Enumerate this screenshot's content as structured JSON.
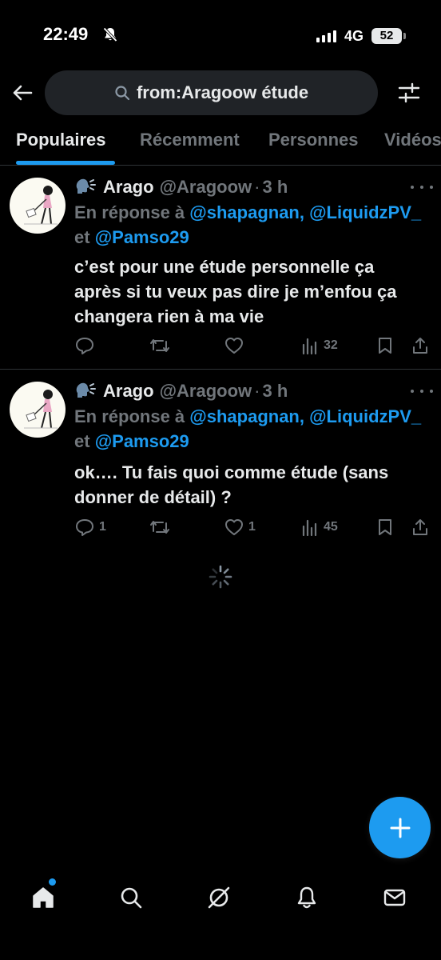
{
  "status_bar": {
    "time": "22:49",
    "network": "4G",
    "battery": "52"
  },
  "header": {
    "search_query": "from:Aragoow étude",
    "icons": [
      "back-arrow-icon",
      "search-icon",
      "filter-sliders-icon"
    ]
  },
  "tabs": [
    {
      "label": "Populaires",
      "active": true
    },
    {
      "label": "Récemment",
      "active": false
    },
    {
      "label": "Personnes",
      "active": false
    },
    {
      "label": "Vidéos",
      "active": false
    }
  ],
  "tweets": [
    {
      "emoji": "🗣️",
      "name": "Arago",
      "handle": "@Aragoow",
      "separator": "·",
      "time": "3 h",
      "reply_prefix": "En réponse à",
      "reply_mentions_1": "@shapagnan, @LiquidzPV_",
      "reply_joiner": "et",
      "reply_mentions_2": "@Pamso29",
      "text_line1": "c’est pour une étude personnelle ça",
      "text_line2": "après si tu veux pas dire je m’enfou ça",
      "text_line3": "changera rien à ma vie",
      "replies": "",
      "retweets": "",
      "likes": "",
      "views": "32"
    },
    {
      "emoji": "🗣️",
      "name": "Arago",
      "handle": "@Aragoow",
      "separator": "·",
      "time": "3 h",
      "reply_prefix": "En réponse à",
      "reply_mentions_1": "@shapagnan, @LiquidzPV_",
      "reply_joiner": "et",
      "reply_mentions_2": "@Pamso29",
      "text_line1": "ok…. Tu fais quoi comme étude (sans",
      "text_line2": "donner de détail) ?",
      "replies": "1",
      "retweets": "",
      "likes": "1",
      "views": "45"
    }
  ],
  "fab": {
    "icon": "plus-icon"
  },
  "bottom_nav": [
    "home-icon",
    "search-icon",
    "grok-icon",
    "notifications-bell-icon",
    "messages-envelope-icon"
  ],
  "colors": {
    "background": "#000000",
    "accent": "#1d9bf0",
    "secondary_text": "#71767b",
    "primary_text": "#e7e9ea",
    "divider": "#2f3336"
  }
}
